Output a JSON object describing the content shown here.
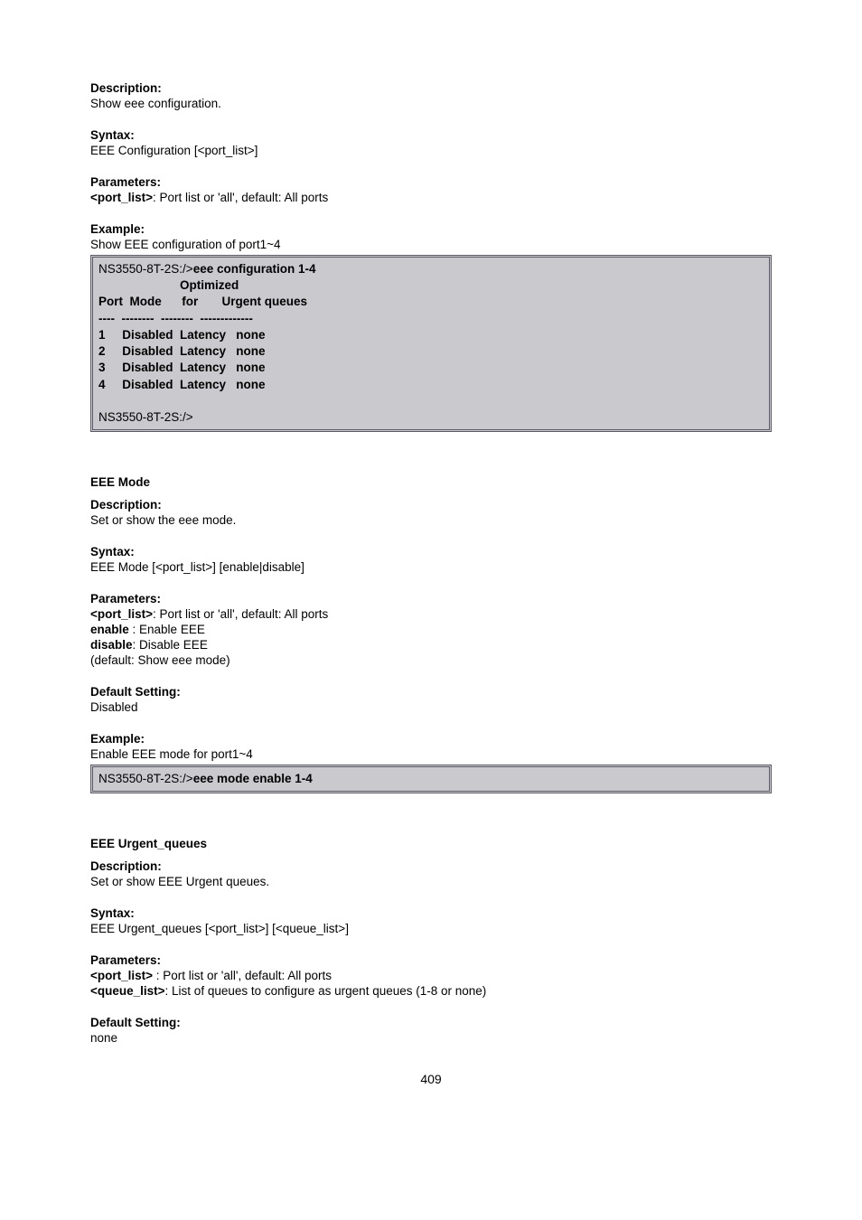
{
  "page_number": "409",
  "config_section": {
    "description_label": "Description:",
    "description": "Show eee configuration.",
    "syntax_label": "Syntax:",
    "syntax": "EEE Configuration [<port_list>]",
    "parameters_label": "Parameters:",
    "param_portlist_key": "<port_list>",
    "param_portlist_desc": ": Port list or 'all', default: All ports",
    "example_label": "Example:",
    "example_desc": "Show EEE configuration of port1~4",
    "code_prompt": "NS3550-8T-2S:/>",
    "code_cmd": "eee configuration 1-4",
    "code_body": "                        Optimized\nPort  Mode      for       Urgent queues\n----  --------  --------  -------------\n1     Disabled  Latency   none\n2     Disabled  Latency   none\n3     Disabled  Latency   none\n4     Disabled  Latency   none",
    "code_tail_prompt": "NS3550-8T-2S:/>"
  },
  "mode_section": {
    "title": "EEE Mode",
    "description_label": "Description:",
    "description": "Set or show the eee mode.",
    "syntax_label": "Syntax:",
    "syntax": "EEE Mode [<port_list>] [enable|disable]",
    "parameters_label": "Parameters:",
    "param_portlist_key": "<port_list>",
    "param_portlist_desc": ": Port list or 'all', default: All ports",
    "param_enable_key": "enable ",
    "param_enable_desc": ": Enable EEE",
    "param_disable_key": "disable",
    "param_disable_desc": ": Disable EEE",
    "param_default": "(default: Show eee mode)",
    "default_label": "Default Setting:",
    "default_text": "Disabled",
    "example_label": "Example:",
    "example_desc": "Enable EEE mode for port1~4",
    "code_prompt": "NS3550-8T-2S:/>",
    "code_cmd": "eee mode enable 1-4"
  },
  "urgent_section": {
    "title": "EEE Urgent_queues",
    "description_label": "Description:",
    "description": "Set or show EEE Urgent queues.",
    "syntax_label": "Syntax:",
    "syntax": "EEE Urgent_queues [<port_list>] [<queue_list>]",
    "parameters_label": "Parameters:",
    "param_portlist_key": "<port_list>  ",
    "param_portlist_desc": ": Port list or 'all', default: All ports",
    "param_queuelist_key": "<queue_list>",
    "param_queuelist_desc": ": List of queues to configure as urgent queues (1-8 or none)",
    "default_label": "Default Setting:",
    "default_text": "none"
  }
}
